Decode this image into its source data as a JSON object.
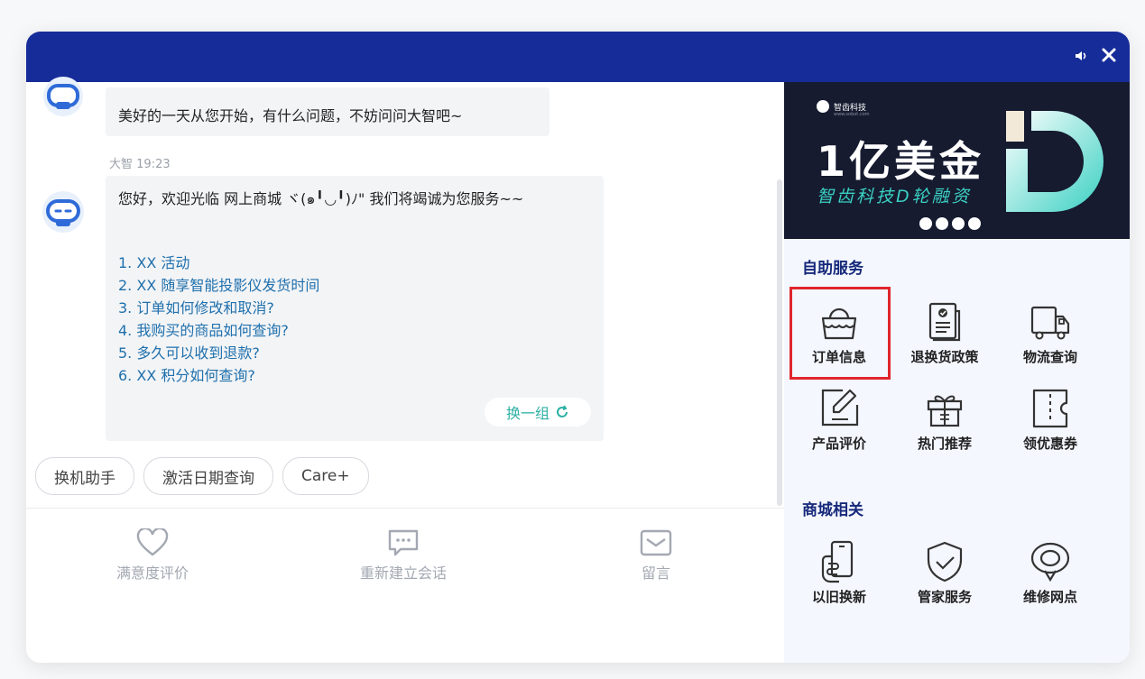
{
  "window": {
    "accent": "#162c99",
    "controls": {
      "sound_icon": "sound-icon",
      "close_icon": "close-icon"
    }
  },
  "chat": {
    "messages": [
      {
        "text": "美好的一天从您开始，有什么问题，不妨问问大智吧~"
      },
      {
        "sender": "大智",
        "time": "19:23",
        "greeting": "您好，欢迎光临      网上商城 ヾ(๑╹◡╹)ﾉ\" 我们将竭诚为您服务~~",
        "questions": [
          "1.  XX  活动",
          "2.  XX  随享智能投影仪发货时间",
          "3. 订单如何修改和取消?",
          "4. 我购买的商品如何查询?",
          "5. 多久可以收到退款?",
          "6.  XX  积分如何查询?"
        ],
        "swap_label": "换一组"
      }
    ],
    "quick_chips": [
      "换机助手",
      "激活日期查询",
      "Care+"
    ],
    "actions": [
      {
        "label": "满意度评价",
        "icon": "heart-icon"
      },
      {
        "label": "重新建立会话",
        "icon": "chat-bubble-icon"
      },
      {
        "label": "留言",
        "icon": "mail-icon"
      }
    ],
    "link_color": "#1f70ad",
    "swap_color": "#2eb0a4"
  },
  "panel": {
    "banner": {
      "brand": "智齿科技",
      "brand_sub": "www.sobot.com",
      "title": "1亿美金",
      "subtitle": "智齿科技D轮融资",
      "slide_count": 4
    },
    "sections": [
      {
        "title": "自助服务",
        "items": [
          {
            "label": "订单信息",
            "icon": "shopping-bag-icon",
            "highlighted": true
          },
          {
            "label": "退换货政策",
            "icon": "policy-document-icon"
          },
          {
            "label": "物流查询",
            "icon": "delivery-truck-icon"
          },
          {
            "label": "产品评价",
            "icon": "edit-review-icon"
          },
          {
            "label": "热门推荐",
            "icon": "gift-icon"
          },
          {
            "label": "领优惠券",
            "icon": "coupon-icon"
          }
        ]
      },
      {
        "title": "商城相关",
        "items": [
          {
            "label": "以旧换新",
            "icon": "phone-trade-in-icon"
          },
          {
            "label": "管家服务",
            "icon": "shield-check-icon"
          },
          {
            "label": "维修网点",
            "icon": "location-pin-icon"
          }
        ]
      }
    ],
    "highlight_color": "#e0262c"
  }
}
